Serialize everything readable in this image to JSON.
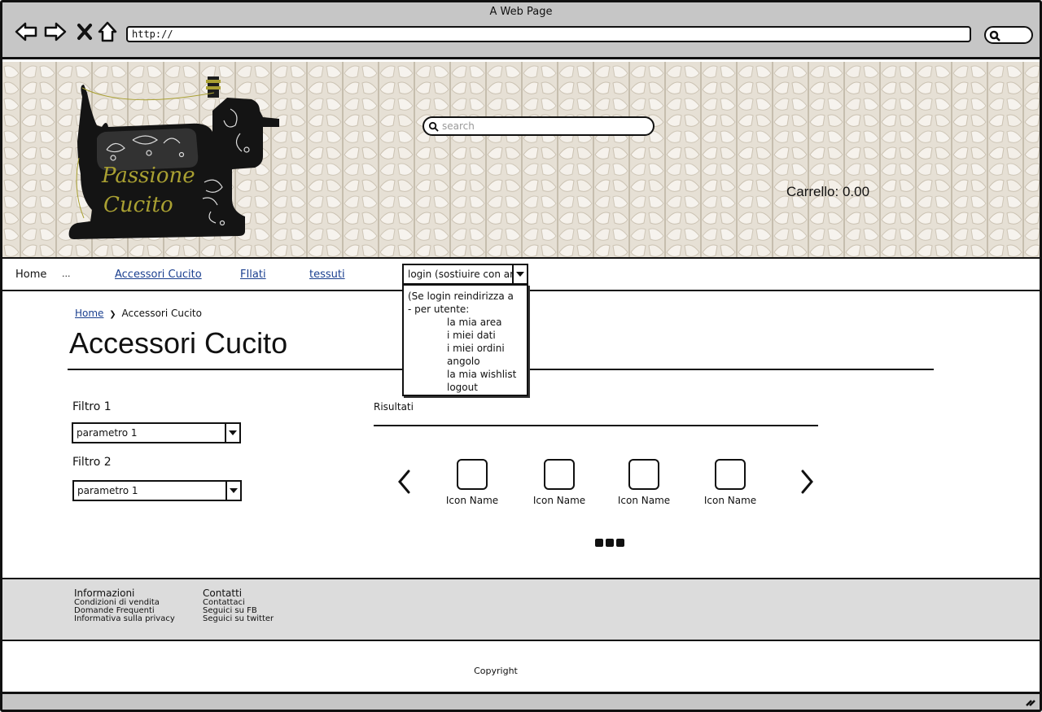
{
  "browser": {
    "window_title": "A Web Page",
    "url": "http://",
    "icons": [
      "back-icon",
      "forward-icon",
      "stop-icon",
      "home-icon",
      "search-icon"
    ]
  },
  "header": {
    "logo_text": [
      "Passione",
      "Cucito"
    ],
    "search_placeholder": "search",
    "cart_label": "Carrello: 0.00"
  },
  "menu": {
    "home": "Home",
    "ellipsis": "...",
    "links": [
      "Accessori Cucito",
      "FIlati",
      "tessuti"
    ],
    "login_select": "login (sostiuire con area",
    "dropdown": {
      "line1": "(Se login reindirizza a",
      "line2": "- per utente:",
      "items": [
        "la mia area",
        "i miei dati",
        "i miei ordini",
        "angolo",
        "la mia wishlist",
        "logout"
      ]
    }
  },
  "content": {
    "breadcrumb_home": "Home",
    "breadcrumb_sep": "❯",
    "breadcrumb_current": "Accessori Cucito",
    "title": "Accessori Cucito",
    "filters": [
      {
        "label": "Filtro 1",
        "value": "parametro 1"
      },
      {
        "label": "Filtro 2",
        "value": "parametro 1"
      }
    ],
    "results_label": "Risultati",
    "items": [
      "Icon Name",
      "Icon Name",
      "Icon Name",
      "Icon Name"
    ]
  },
  "footer": {
    "col1": {
      "title": "Informazioni",
      "links": [
        "Condizioni di vendita",
        "Domande Frequenti",
        "Informativa sulla privacy"
      ]
    },
    "col2": {
      "title": "Contatti",
      "links": [
        "Contattaci",
        "Seguici su FB",
        "Seguici su twitter"
      ]
    },
    "copyright": "Copyright"
  },
  "colors": {
    "chrome": "#c6c6c6",
    "link": "#1a3f8f",
    "footer": "#dcdcdc",
    "logo_text": "#a9a032"
  }
}
